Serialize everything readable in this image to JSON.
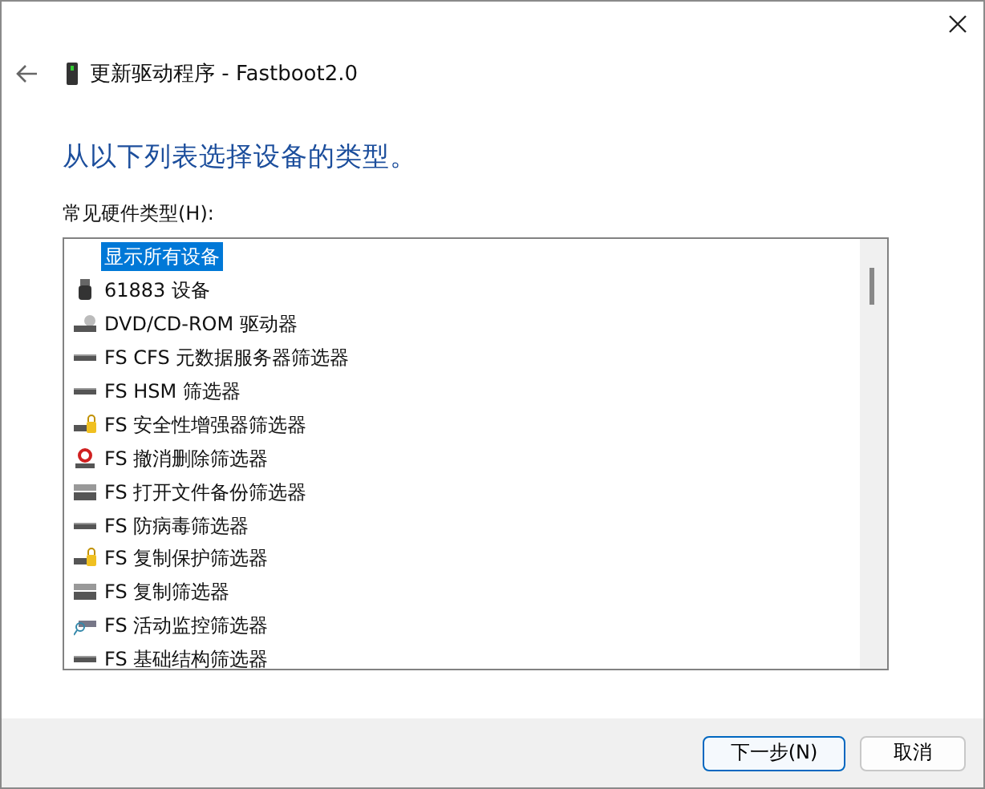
{
  "window": {
    "title": "更新驱动程序 - Fastboot2.0"
  },
  "heading": "从以下列表选择设备的类型。",
  "list_label": "常见硬件类型(H):",
  "items": [
    {
      "label": "显示所有设备",
      "kind": "none",
      "selected": true
    },
    {
      "label": "61883 设备",
      "kind": "usb",
      "selected": false
    },
    {
      "label": "DVD/CD-ROM 驱动器",
      "kind": "dvd",
      "selected": false
    },
    {
      "label": "FS CFS 元数据服务器筛选器",
      "kind": "drive",
      "selected": false
    },
    {
      "label": "FS HSM 筛选器",
      "kind": "drive",
      "selected": false
    },
    {
      "label": "FS 安全性增强器筛选器",
      "kind": "drive-lock",
      "selected": false
    },
    {
      "label": "FS 撤消删除筛选器",
      "kind": "drive-restore",
      "selected": false
    },
    {
      "label": "FS 打开文件备份筛选器",
      "kind": "drive-stack",
      "selected": false
    },
    {
      "label": "FS 防病毒筛选器",
      "kind": "drive",
      "selected": false
    },
    {
      "label": "FS 复制保护筛选器",
      "kind": "drive-lock",
      "selected": false
    },
    {
      "label": "FS 复制筛选器",
      "kind": "drive-stack",
      "selected": false
    },
    {
      "label": "FS 活动监控筛选器",
      "kind": "drive-monitor",
      "selected": false
    },
    {
      "label": "FS 基础结构筛选器",
      "kind": "drive",
      "selected": false
    }
  ],
  "buttons": [
    {
      "label": "下一步(N)",
      "kind": "default"
    },
    {
      "label": "取消",
      "kind": "normal"
    }
  ]
}
